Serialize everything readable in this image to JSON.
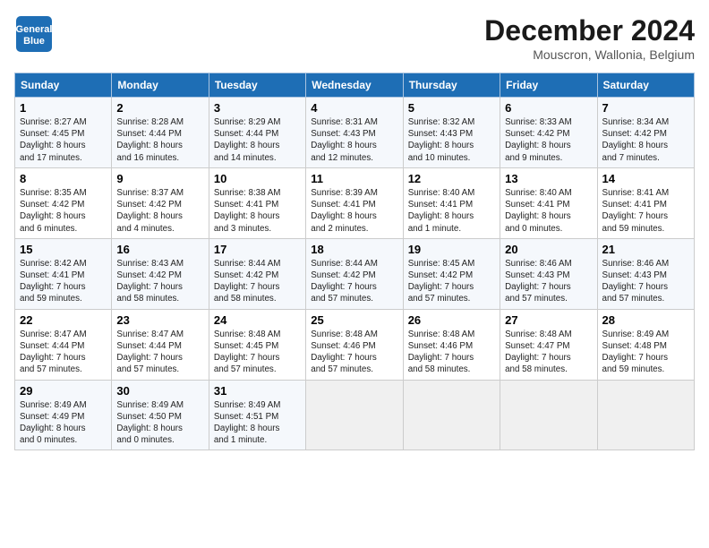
{
  "logo": {
    "line1": "General",
    "line2": "Blue"
  },
  "title": "December 2024",
  "subtitle": "Mouscron, Wallonia, Belgium",
  "headers": [
    "Sunday",
    "Monday",
    "Tuesday",
    "Wednesday",
    "Thursday",
    "Friday",
    "Saturday"
  ],
  "weeks": [
    [
      {
        "day": "1",
        "lines": [
          "Sunrise: 8:27 AM",
          "Sunset: 4:45 PM",
          "Daylight: 8 hours",
          "and 17 minutes."
        ]
      },
      {
        "day": "2",
        "lines": [
          "Sunrise: 8:28 AM",
          "Sunset: 4:44 PM",
          "Daylight: 8 hours",
          "and 16 minutes."
        ]
      },
      {
        "day": "3",
        "lines": [
          "Sunrise: 8:29 AM",
          "Sunset: 4:44 PM",
          "Daylight: 8 hours",
          "and 14 minutes."
        ]
      },
      {
        "day": "4",
        "lines": [
          "Sunrise: 8:31 AM",
          "Sunset: 4:43 PM",
          "Daylight: 8 hours",
          "and 12 minutes."
        ]
      },
      {
        "day": "5",
        "lines": [
          "Sunrise: 8:32 AM",
          "Sunset: 4:43 PM",
          "Daylight: 8 hours",
          "and 10 minutes."
        ]
      },
      {
        "day": "6",
        "lines": [
          "Sunrise: 8:33 AM",
          "Sunset: 4:42 PM",
          "Daylight: 8 hours",
          "and 9 minutes."
        ]
      },
      {
        "day": "7",
        "lines": [
          "Sunrise: 8:34 AM",
          "Sunset: 4:42 PM",
          "Daylight: 8 hours",
          "and 7 minutes."
        ]
      }
    ],
    [
      {
        "day": "8",
        "lines": [
          "Sunrise: 8:35 AM",
          "Sunset: 4:42 PM",
          "Daylight: 8 hours",
          "and 6 minutes."
        ]
      },
      {
        "day": "9",
        "lines": [
          "Sunrise: 8:37 AM",
          "Sunset: 4:42 PM",
          "Daylight: 8 hours",
          "and 4 minutes."
        ]
      },
      {
        "day": "10",
        "lines": [
          "Sunrise: 8:38 AM",
          "Sunset: 4:41 PM",
          "Daylight: 8 hours",
          "and 3 minutes."
        ]
      },
      {
        "day": "11",
        "lines": [
          "Sunrise: 8:39 AM",
          "Sunset: 4:41 PM",
          "Daylight: 8 hours",
          "and 2 minutes."
        ]
      },
      {
        "day": "12",
        "lines": [
          "Sunrise: 8:40 AM",
          "Sunset: 4:41 PM",
          "Daylight: 8 hours",
          "and 1 minute."
        ]
      },
      {
        "day": "13",
        "lines": [
          "Sunrise: 8:40 AM",
          "Sunset: 4:41 PM",
          "Daylight: 8 hours",
          "and 0 minutes."
        ]
      },
      {
        "day": "14",
        "lines": [
          "Sunrise: 8:41 AM",
          "Sunset: 4:41 PM",
          "Daylight: 7 hours",
          "and 59 minutes."
        ]
      }
    ],
    [
      {
        "day": "15",
        "lines": [
          "Sunrise: 8:42 AM",
          "Sunset: 4:41 PM",
          "Daylight: 7 hours",
          "and 59 minutes."
        ]
      },
      {
        "day": "16",
        "lines": [
          "Sunrise: 8:43 AM",
          "Sunset: 4:42 PM",
          "Daylight: 7 hours",
          "and 58 minutes."
        ]
      },
      {
        "day": "17",
        "lines": [
          "Sunrise: 8:44 AM",
          "Sunset: 4:42 PM",
          "Daylight: 7 hours",
          "and 58 minutes."
        ]
      },
      {
        "day": "18",
        "lines": [
          "Sunrise: 8:44 AM",
          "Sunset: 4:42 PM",
          "Daylight: 7 hours",
          "and 57 minutes."
        ]
      },
      {
        "day": "19",
        "lines": [
          "Sunrise: 8:45 AM",
          "Sunset: 4:42 PM",
          "Daylight: 7 hours",
          "and 57 minutes."
        ]
      },
      {
        "day": "20",
        "lines": [
          "Sunrise: 8:46 AM",
          "Sunset: 4:43 PM",
          "Daylight: 7 hours",
          "and 57 minutes."
        ]
      },
      {
        "day": "21",
        "lines": [
          "Sunrise: 8:46 AM",
          "Sunset: 4:43 PM",
          "Daylight: 7 hours",
          "and 57 minutes."
        ]
      }
    ],
    [
      {
        "day": "22",
        "lines": [
          "Sunrise: 8:47 AM",
          "Sunset: 4:44 PM",
          "Daylight: 7 hours",
          "and 57 minutes."
        ]
      },
      {
        "day": "23",
        "lines": [
          "Sunrise: 8:47 AM",
          "Sunset: 4:44 PM",
          "Daylight: 7 hours",
          "and 57 minutes."
        ]
      },
      {
        "day": "24",
        "lines": [
          "Sunrise: 8:48 AM",
          "Sunset: 4:45 PM",
          "Daylight: 7 hours",
          "and 57 minutes."
        ]
      },
      {
        "day": "25",
        "lines": [
          "Sunrise: 8:48 AM",
          "Sunset: 4:46 PM",
          "Daylight: 7 hours",
          "and 57 minutes."
        ]
      },
      {
        "day": "26",
        "lines": [
          "Sunrise: 8:48 AM",
          "Sunset: 4:46 PM",
          "Daylight: 7 hours",
          "and 58 minutes."
        ]
      },
      {
        "day": "27",
        "lines": [
          "Sunrise: 8:48 AM",
          "Sunset: 4:47 PM",
          "Daylight: 7 hours",
          "and 58 minutes."
        ]
      },
      {
        "day": "28",
        "lines": [
          "Sunrise: 8:49 AM",
          "Sunset: 4:48 PM",
          "Daylight: 7 hours",
          "and 59 minutes."
        ]
      }
    ],
    [
      {
        "day": "29",
        "lines": [
          "Sunrise: 8:49 AM",
          "Sunset: 4:49 PM",
          "Daylight: 8 hours",
          "and 0 minutes."
        ]
      },
      {
        "day": "30",
        "lines": [
          "Sunrise: 8:49 AM",
          "Sunset: 4:50 PM",
          "Daylight: 8 hours",
          "and 0 minutes."
        ]
      },
      {
        "day": "31",
        "lines": [
          "Sunrise: 8:49 AM",
          "Sunset: 4:51 PM",
          "Daylight: 8 hours",
          "and 1 minute."
        ]
      },
      null,
      null,
      null,
      null
    ]
  ]
}
